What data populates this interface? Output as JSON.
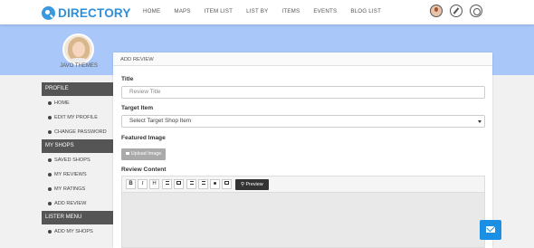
{
  "brand": {
    "logo_text": "DIRECTORY",
    "accent_color": "#2e8fda",
    "banner_color": "#a9c8f9"
  },
  "nav": [
    "HOME",
    "MAPS",
    "ITEM LIST",
    "LIST BY",
    "ITEMS",
    "EVENTS",
    "BLOG LIST"
  ],
  "header_icons": [
    "user-avatar-icon",
    "compass-icon",
    "power-icon"
  ],
  "profile": {
    "name": "JAVO THEMES"
  },
  "sidebar": {
    "sections": [
      {
        "title": "PROFILE",
        "items": [
          "HOME",
          "EDIT MY PROFILE",
          "CHANGE PASSWORD"
        ]
      },
      {
        "title": "MY SHOPS",
        "items": [
          "SAVED SHOPS",
          "MY REVIEWS",
          "MY RATINGS",
          "ADD REVIEW"
        ]
      },
      {
        "title": "LISTER MENU",
        "items": [
          "ADD MY SHOPS"
        ]
      }
    ]
  },
  "panel": {
    "header": "ADD REVIEW",
    "title_label": "Title",
    "title_placeholder": "Review Title",
    "target_label": "Target Item",
    "target_value": "Select Target Shop Item",
    "featured_label": "Featured Image",
    "upload_label": "Upload Image",
    "content_label": "Review Content",
    "toolbar": {
      "bold": "B",
      "italic": "I",
      "heading": "H",
      "preview": "Preview"
    }
  }
}
